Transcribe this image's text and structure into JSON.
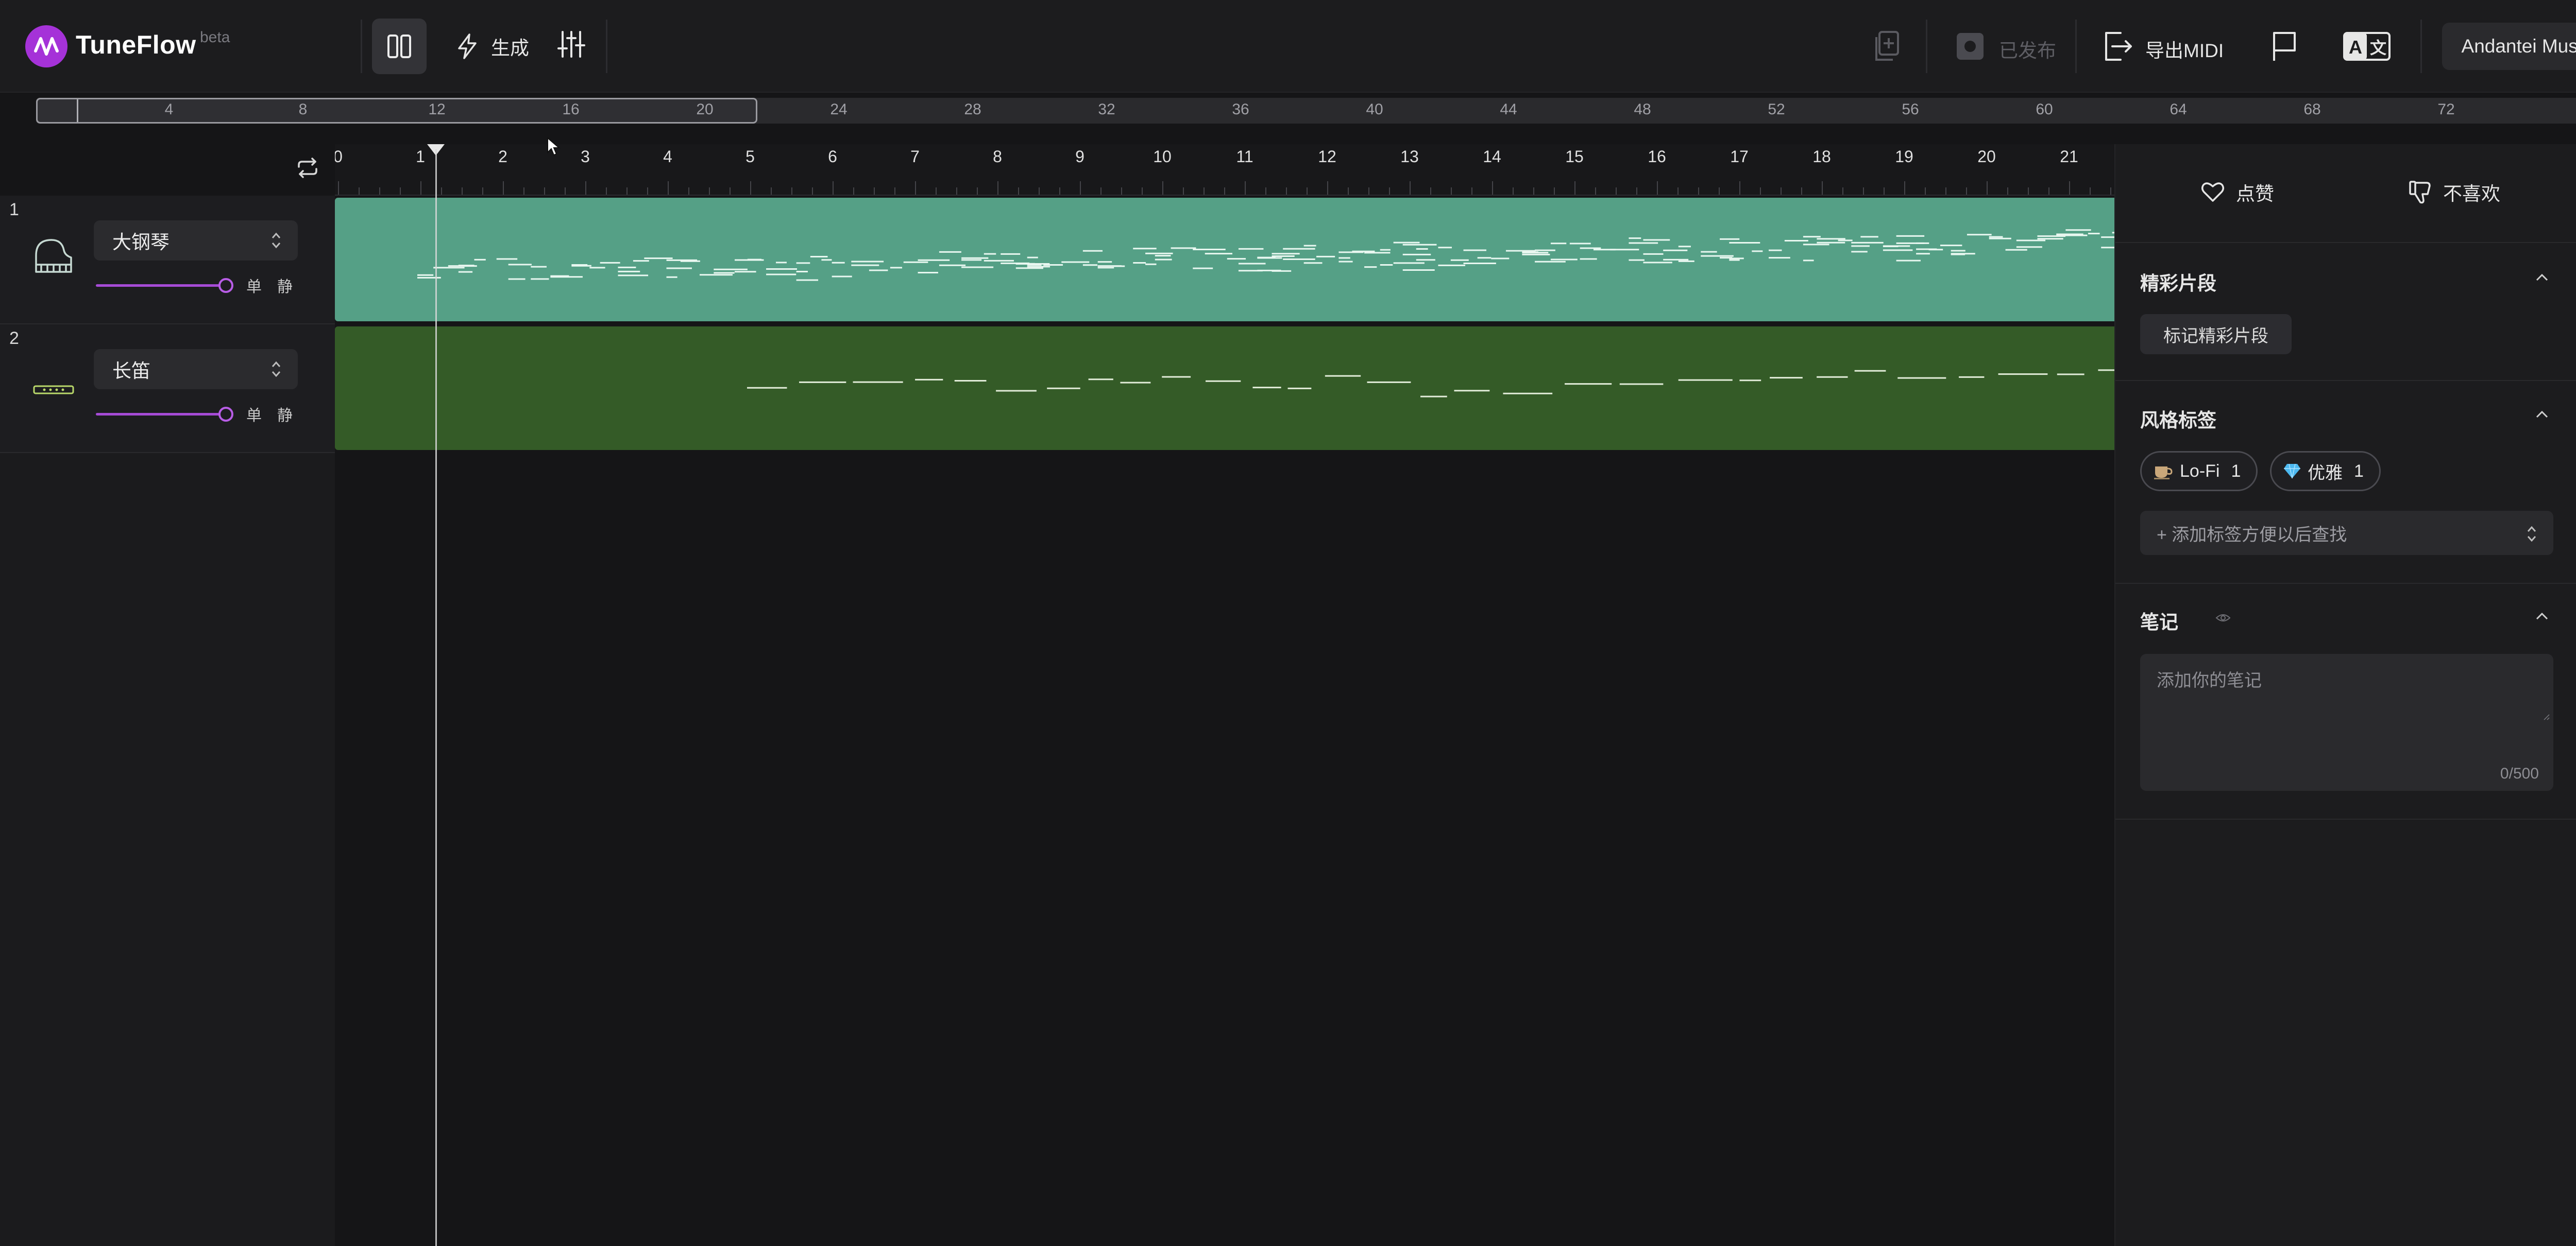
{
  "app": {
    "name": "TuneFlow",
    "badge": "beta"
  },
  "header": {
    "generate_label": "生成",
    "published_label": "已发布",
    "export_label": "导出MIDI",
    "account_label": "Andantei Music"
  },
  "overview": {
    "ticks": [
      "4",
      "8",
      "12",
      "16",
      "20",
      "24",
      "28",
      "32",
      "36",
      "40",
      "44",
      "48",
      "52",
      "56",
      "60",
      "64",
      "68",
      "72"
    ]
  },
  "timeline": {
    "bars": [
      "0",
      "1",
      "2",
      "3",
      "4",
      "5",
      "6",
      "7",
      "8",
      "9",
      "10",
      "11",
      "12",
      "13",
      "14",
      "15",
      "16",
      "17",
      "18",
      "19",
      "20",
      "21"
    ]
  },
  "tracks": [
    {
      "number": "1",
      "instrument": "大钢琴",
      "solo": "单",
      "mute": "静"
    },
    {
      "number": "2",
      "instrument": "长笛",
      "solo": "单",
      "mute": "静"
    }
  ],
  "panel": {
    "like": "点赞",
    "dislike": "不喜欢",
    "highlights_title": "精彩片段",
    "highlights_button": "标记精彩片段",
    "style_tags_title": "风格标签",
    "tags": [
      {
        "label": "Lo-Fi",
        "count": "1"
      },
      {
        "label": "优雅",
        "count": "1"
      }
    ],
    "tag_placeholder": "+ 添加标签方便以后查找",
    "notes_title": "笔记",
    "notes_placeholder": "添加你的笔记",
    "notes_count": "0/500"
  },
  "colors": {
    "accent": "#b85de6",
    "piano_clip": "#55a086",
    "flute_clip": "#345b27",
    "background": "#151517"
  }
}
